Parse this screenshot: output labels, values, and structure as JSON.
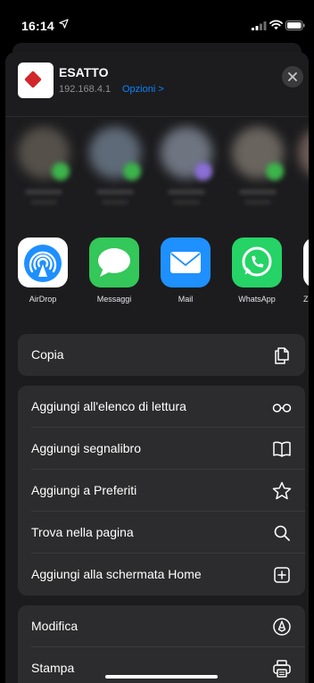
{
  "status_bar": {
    "time": "16:14",
    "icons": [
      "location-arrow-icon",
      "cellular-signal-icon",
      "wifi-icon",
      "battery-icon"
    ]
  },
  "share_header": {
    "title": "ESATTO",
    "host": "192.168.4.1",
    "options_label": "Opzioni >",
    "options_color": "#0a84ff",
    "close_icon": "close-icon"
  },
  "apps": [
    {
      "label": "AirDrop",
      "icon": "airdrop-icon",
      "color": "#ffffff"
    },
    {
      "label": "Messaggi",
      "icon": "messages-icon",
      "color": "#34c759"
    },
    {
      "label": "Mail",
      "icon": "mail-icon",
      "color": "#1e90ff"
    },
    {
      "label": "WhatsApp",
      "icon": "whatsapp-icon",
      "color": "#25d366"
    },
    {
      "label": "Z",
      "icon": "app-icon",
      "color": "#ffffff"
    }
  ],
  "actions_group1": [
    {
      "label": "Copia",
      "icon": "copy-icon"
    }
  ],
  "actions_group2": [
    {
      "label": "Aggiungi all'elenco di lettura",
      "icon": "glasses-icon"
    },
    {
      "label": "Aggiungi segnalibro",
      "icon": "book-icon"
    },
    {
      "label": "Aggiungi a Preferiti",
      "icon": "star-icon"
    },
    {
      "label": "Trova nella pagina",
      "icon": "search-icon"
    },
    {
      "label": "Aggiungi alla schermata Home",
      "icon": "add-square-icon"
    }
  ],
  "actions_group3": [
    {
      "label": "Modifica",
      "icon": "markup-icon"
    },
    {
      "label": "Stampa",
      "icon": "printer-icon"
    }
  ]
}
